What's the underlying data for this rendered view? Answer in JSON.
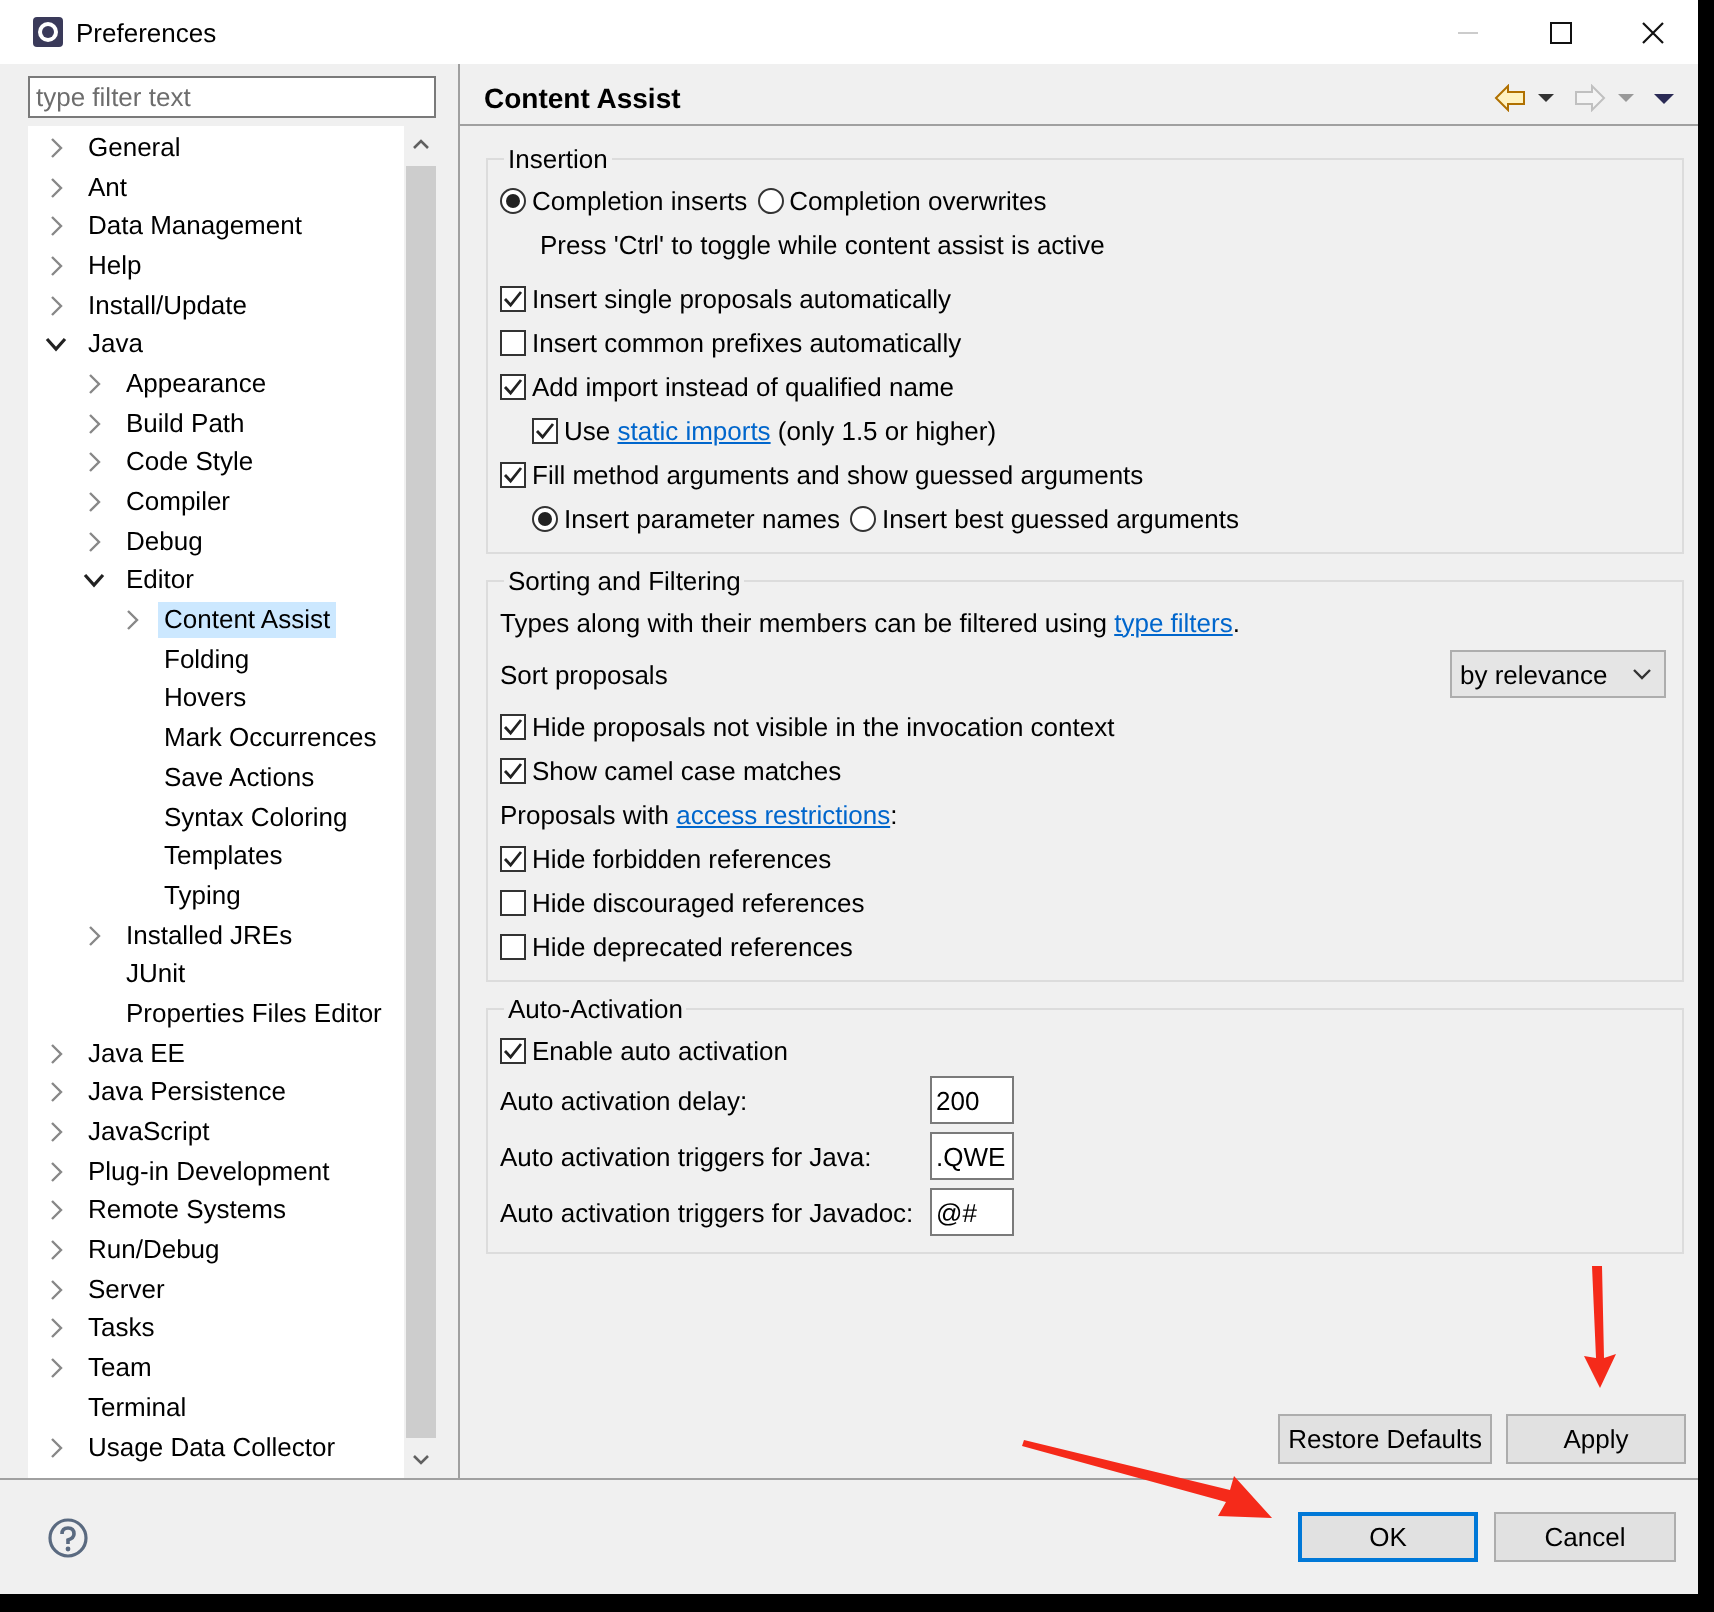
{
  "window": {
    "title": "Preferences"
  },
  "filter": {
    "placeholder": "type filter text"
  },
  "tree": [
    {
      "label": "General",
      "expanded": false,
      "selected": false
    },
    {
      "label": "Ant",
      "expanded": false,
      "selected": false
    },
    {
      "label": "Data Management",
      "expanded": false,
      "selected": false
    },
    {
      "label": "Help",
      "expanded": false,
      "selected": false
    },
    {
      "label": "Install/Update",
      "expanded": false,
      "selected": false
    },
    {
      "label": "Java",
      "expanded": true,
      "selected": false,
      "children": [
        {
          "label": "Appearance",
          "expanded": false,
          "selected": false
        },
        {
          "label": "Build Path",
          "expanded": false,
          "selected": false
        },
        {
          "label": "Code Style",
          "expanded": false,
          "selected": false
        },
        {
          "label": "Compiler",
          "expanded": false,
          "selected": false
        },
        {
          "label": "Debug",
          "expanded": false,
          "selected": false
        },
        {
          "label": "Editor",
          "expanded": true,
          "selected": false,
          "children": [
            {
              "label": "Content Assist",
              "expanded": false,
              "selected": true
            },
            {
              "label": "Folding",
              "selected": false
            },
            {
              "label": "Hovers",
              "selected": false
            },
            {
              "label": "Mark Occurrences",
              "selected": false
            },
            {
              "label": "Save Actions",
              "selected": false
            },
            {
              "label": "Syntax Coloring",
              "selected": false
            },
            {
              "label": "Templates",
              "selected": false
            },
            {
              "label": "Typing",
              "selected": false
            }
          ]
        },
        {
          "label": "Installed JREs",
          "expanded": false,
          "selected": false
        },
        {
          "label": "JUnit",
          "selected": false
        },
        {
          "label": "Properties Files Editor",
          "selected": false
        }
      ]
    },
    {
      "label": "Java EE",
      "expanded": false,
      "selected": false
    },
    {
      "label": "Java Persistence",
      "expanded": false,
      "selected": false
    },
    {
      "label": "JavaScript",
      "expanded": false,
      "selected": false
    },
    {
      "label": "Plug-in Development",
      "expanded": false,
      "selected": false
    },
    {
      "label": "Remote Systems",
      "expanded": false,
      "selected": false
    },
    {
      "label": "Run/Debug",
      "expanded": false,
      "selected": false
    },
    {
      "label": "Server",
      "expanded": false,
      "selected": false
    },
    {
      "label": "Tasks",
      "expanded": false,
      "selected": false
    },
    {
      "label": "Team",
      "expanded": false,
      "selected": false
    },
    {
      "label": "Terminal",
      "selected": false
    },
    {
      "label": "Usage Data Collector",
      "expanded": false,
      "selected": false
    }
  ],
  "page": {
    "title": "Content Assist",
    "back_enabled": true,
    "forward_enabled": false
  },
  "groups": [
    {
      "title": "Insertion",
      "rows": [
        {
          "kind": "radios",
          "options": [
            {
              "label": "Completion inserts",
              "selected": true
            },
            {
              "label": "Completion overwrites",
              "selected": false
            }
          ],
          "children": [
            {
              "kind": "note",
              "text": "Press 'Ctrl' to toggle while content assist is active"
            }
          ]
        },
        {
          "kind": "checkbox",
          "label": "Insert single proposals automatically",
          "checked": true
        },
        {
          "kind": "checkbox",
          "label": "Insert common prefixes automatically",
          "checked": false
        },
        {
          "kind": "checkbox",
          "label": "Add import instead of qualified name",
          "checked": true,
          "children": [
            {
              "kind": "checkbox",
              "label": "Use ",
              "link": "static imports",
              "after": " (only 1.5 or higher)",
              "checked": true
            }
          ]
        },
        {
          "kind": "checkbox",
          "label": "Fill method arguments and show guessed arguments",
          "checked": true,
          "children": [
            {
              "kind": "radios",
              "options": [
                {
                  "label": "Insert parameter names",
                  "selected": true
                },
                {
                  "label": "Insert best guessed arguments",
                  "selected": false
                }
              ]
            }
          ]
        }
      ]
    },
    {
      "title": "Sorting and Filtering",
      "rows": [
        {
          "kind": "text",
          "text": "Types along with their members can be filtered using ",
          "link": "type filters",
          "after": "."
        },
        {
          "kind": "select",
          "label": "Sort proposals",
          "value": "by relevance"
        },
        {
          "kind": "checkbox",
          "label": "Hide proposals not visible in the invocation context",
          "checked": true
        },
        {
          "kind": "checkbox",
          "label": "Show camel case matches",
          "checked": true
        },
        {
          "kind": "text",
          "text": "Proposals with ",
          "link": "access restrictions",
          "after": ":"
        },
        {
          "kind": "checkbox",
          "label": "Hide forbidden references",
          "checked": true
        },
        {
          "kind": "checkbox",
          "label": "Hide discouraged references",
          "checked": false
        },
        {
          "kind": "checkbox",
          "label": "Hide deprecated references",
          "checked": false
        }
      ]
    },
    {
      "title": "Auto-Activation",
      "rows": [
        {
          "kind": "checkbox",
          "label": "Enable auto activation",
          "checked": true
        },
        {
          "kind": "field",
          "label": "Auto activation delay:",
          "value": "200"
        },
        {
          "kind": "field",
          "label": "Auto activation triggers for Java:",
          "value": ".QWE"
        },
        {
          "kind": "field",
          "label": "Auto activation triggers for Javadoc:",
          "value": "@#"
        }
      ]
    }
  ],
  "page_buttons": [
    {
      "label": "Restore Defaults",
      "arrow_pointing": false
    },
    {
      "label": "Apply",
      "arrow_pointing": true
    }
  ],
  "dialog_buttons": [
    {
      "label": "OK",
      "default": true,
      "arrow_pointing": true
    },
    {
      "label": "Cancel",
      "default": false,
      "arrow_pointing": false
    }
  ]
}
